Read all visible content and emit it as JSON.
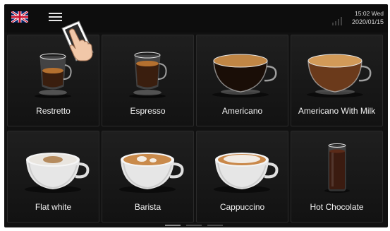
{
  "header": {
    "language_icon": "uk-flag-icon",
    "menu_icon": "hamburger-menu-icon",
    "signal_icon": "signal-strength-icon",
    "time": "15:02 Wed",
    "date": "2020/01/15"
  },
  "drinks": [
    {
      "label": "Restretto",
      "icon": "glass-espresso-cup-icon"
    },
    {
      "label": "Espresso",
      "icon": "glass-espresso-cup-icon"
    },
    {
      "label": "Americano",
      "icon": "glass-coffee-cup-icon"
    },
    {
      "label": "Americano With Milk",
      "icon": "glass-coffee-cup-icon"
    },
    {
      "label": "Flat white",
      "icon": "white-latte-cup-icon"
    },
    {
      "label": "Barista",
      "icon": "white-latte-cup-icon"
    },
    {
      "label": "Cappuccino",
      "icon": "white-latte-cup-icon"
    },
    {
      "label": "Hot Chocolate",
      "icon": "tall-glass-chocolate-icon"
    }
  ],
  "pager": {
    "pages": 3,
    "active": 1
  }
}
